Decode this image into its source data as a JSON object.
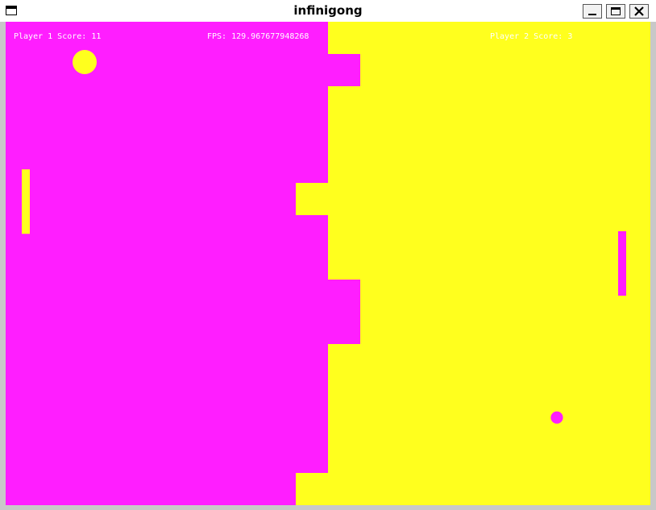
{
  "window": {
    "title": "infinigong",
    "buttons": {
      "minimize": "minimize",
      "maximize": "maximize",
      "close": "close"
    }
  },
  "hud": {
    "player1": "Player 1 Score: 11",
    "fps": "FPS: 129.967677948268",
    "player2": "Player 2 Score: 3"
  },
  "colors": {
    "player1_territory": "#ff1eff",
    "player2_territory": "#ffff1e",
    "hud_text": "#ffffff"
  },
  "game": {
    "field": {
      "rows": 15,
      "cols": 20
    },
    "border_columns": [
      10,
      11,
      10,
      10,
      10,
      9,
      10,
      10,
      11,
      11,
      10,
      10,
      10,
      10,
      9
    ],
    "player1_paddle": {
      "col": 0.5,
      "row_top": 4.58,
      "rows": 2
    },
    "player2_paddle": {
      "col": 19.0,
      "row_top": 6.5,
      "rows": 2
    },
    "ball_player1": {
      "col": 2.45,
      "row": 1.25,
      "diameter_cells": 0.75,
      "color_owner": "player2"
    },
    "ball_player2": {
      "col": 17.1,
      "row": 12.28,
      "diameter_cells": 0.38,
      "color_owner": "player1"
    }
  }
}
